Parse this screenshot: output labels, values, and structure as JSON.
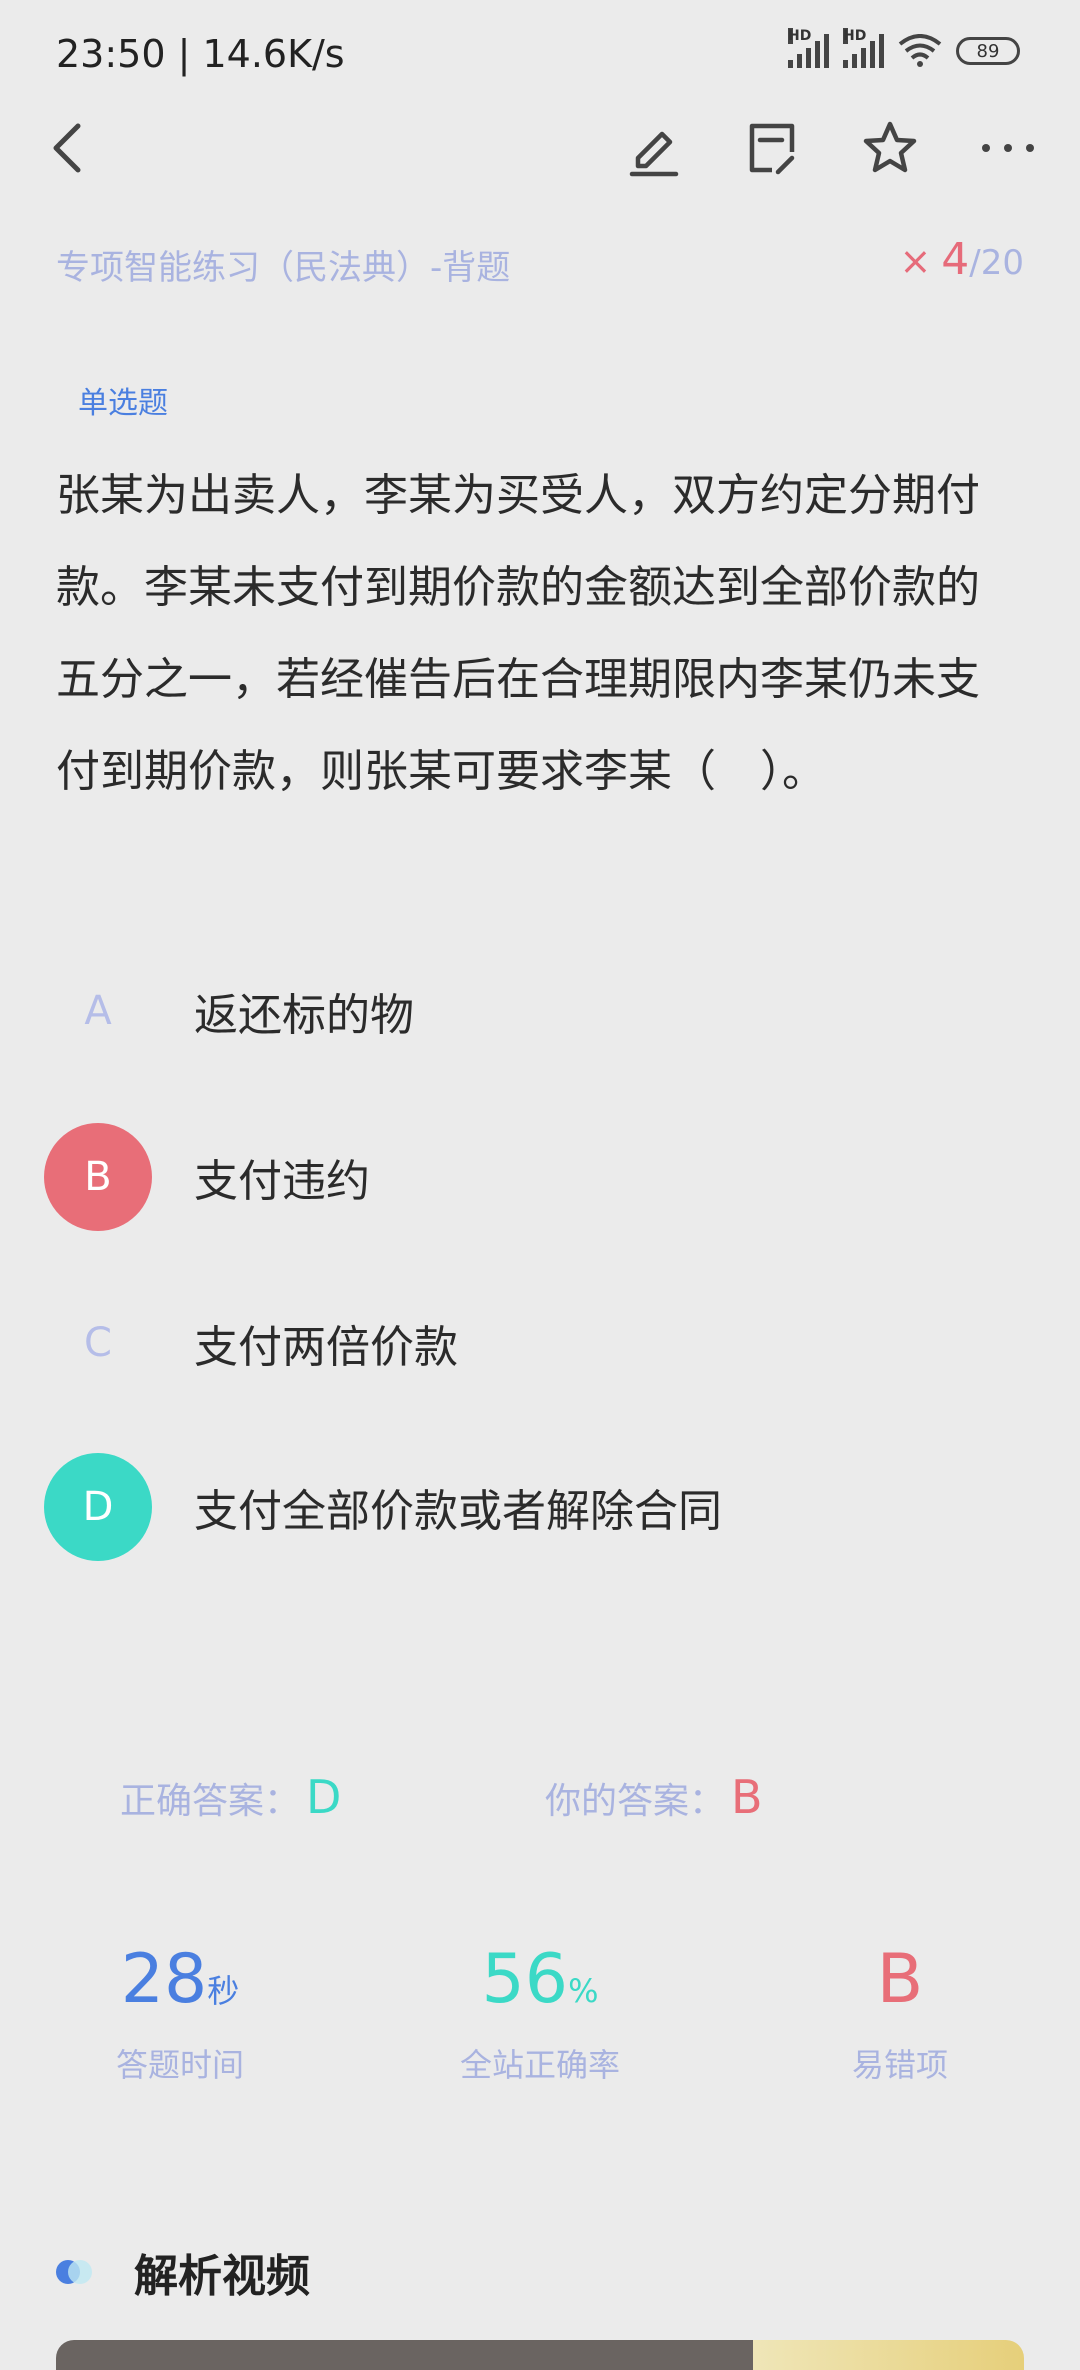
{
  "status_bar": {
    "time_speed": "23:50 | 14.6K/s",
    "hd1": "HD",
    "hd2": "HD",
    "battery": "89"
  },
  "toolbar": {
    "icons": [
      "back-icon",
      "edit-icon",
      "note-icon",
      "star-icon",
      "more-icon"
    ]
  },
  "exam": {
    "title": "专项智能练习（民法典）-背题",
    "wrong_mark": "×",
    "current": "4",
    "total": "/20"
  },
  "question": {
    "type": "单选题",
    "text": "张某为出卖人，李某为买受人，双方约定分期付款。李某未支付到期价款的金额达到全部价款的五分之一，若经催告后在合理期限内李某仍未支付到期价款，则张某可要求李某（　）。",
    "options": [
      {
        "letter": "A",
        "text": "返还标的物"
      },
      {
        "letter": "B",
        "text": "支付违约"
      },
      {
        "letter": "C",
        "text": "支付两倍价款"
      },
      {
        "letter": "D",
        "text": "支付全部价款或者解除合同"
      }
    ]
  },
  "answer": {
    "correct_label": "正确答案：",
    "correct_value": "D",
    "yours_label": "你的答案：",
    "yours_value": "B"
  },
  "stats": {
    "time_value": "28",
    "time_unit": "秒",
    "time_label": "答题时间",
    "rate_value": "56",
    "rate_unit": "%",
    "rate_label": "全站正确率",
    "error_value": "B",
    "error_label": "易错项"
  },
  "section": {
    "title": "解析视频"
  },
  "colors": {
    "accent_blue": "#4a7fe0",
    "wrong_red": "#e86e78",
    "correct_teal": "#3bd9c6",
    "muted_purple": "#a9b3e0"
  }
}
